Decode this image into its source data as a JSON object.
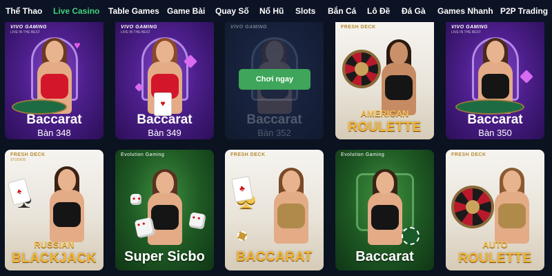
{
  "nav": {
    "items": [
      "Thể Thao",
      "Live Casino",
      "Table Games",
      "Game Bài",
      "Quay Số",
      "Nổ Hũ",
      "Slots",
      "Bắn Cá",
      "Lô Đề",
      "Đá Gà",
      "Games Nhanh",
      "P2P Trading"
    ],
    "active": "Live Casino"
  },
  "brands": {
    "vivo": "VIVO GAMING",
    "vivo_sub": "LIVE IN THE BEST",
    "fresh": "FRESH DECK",
    "fresh_sub": "STUDIOS",
    "evo": "Evolution Gaming"
  },
  "row1": [
    {
      "title": "Baccarat",
      "subtitle": "Bàn 348"
    },
    {
      "title": "Baccarat",
      "subtitle": "Bàn 349"
    },
    {
      "title": "Baccarat",
      "subtitle": "Bàn 352",
      "button": "Chơi ngay"
    },
    {
      "title_line1": "AMERICAN",
      "title_line2": "ROULETTE"
    },
    {
      "title": "Baccarat",
      "subtitle": "Bàn 350"
    }
  ],
  "row2": [
    {
      "title_line1": "RUSSIAN",
      "title_line2": "BLACKJACK"
    },
    {
      "title": "Super Sicbo"
    },
    {
      "title": "BACCARAT"
    },
    {
      "title": "Baccarat"
    },
    {
      "title_line1": "AUTO",
      "title_line2": "ROULETTE"
    }
  ],
  "colors": {
    "accent": "#3fd37a",
    "button": "#3ea55a",
    "background": "#0b1220",
    "gold_title": "#f5b531"
  }
}
